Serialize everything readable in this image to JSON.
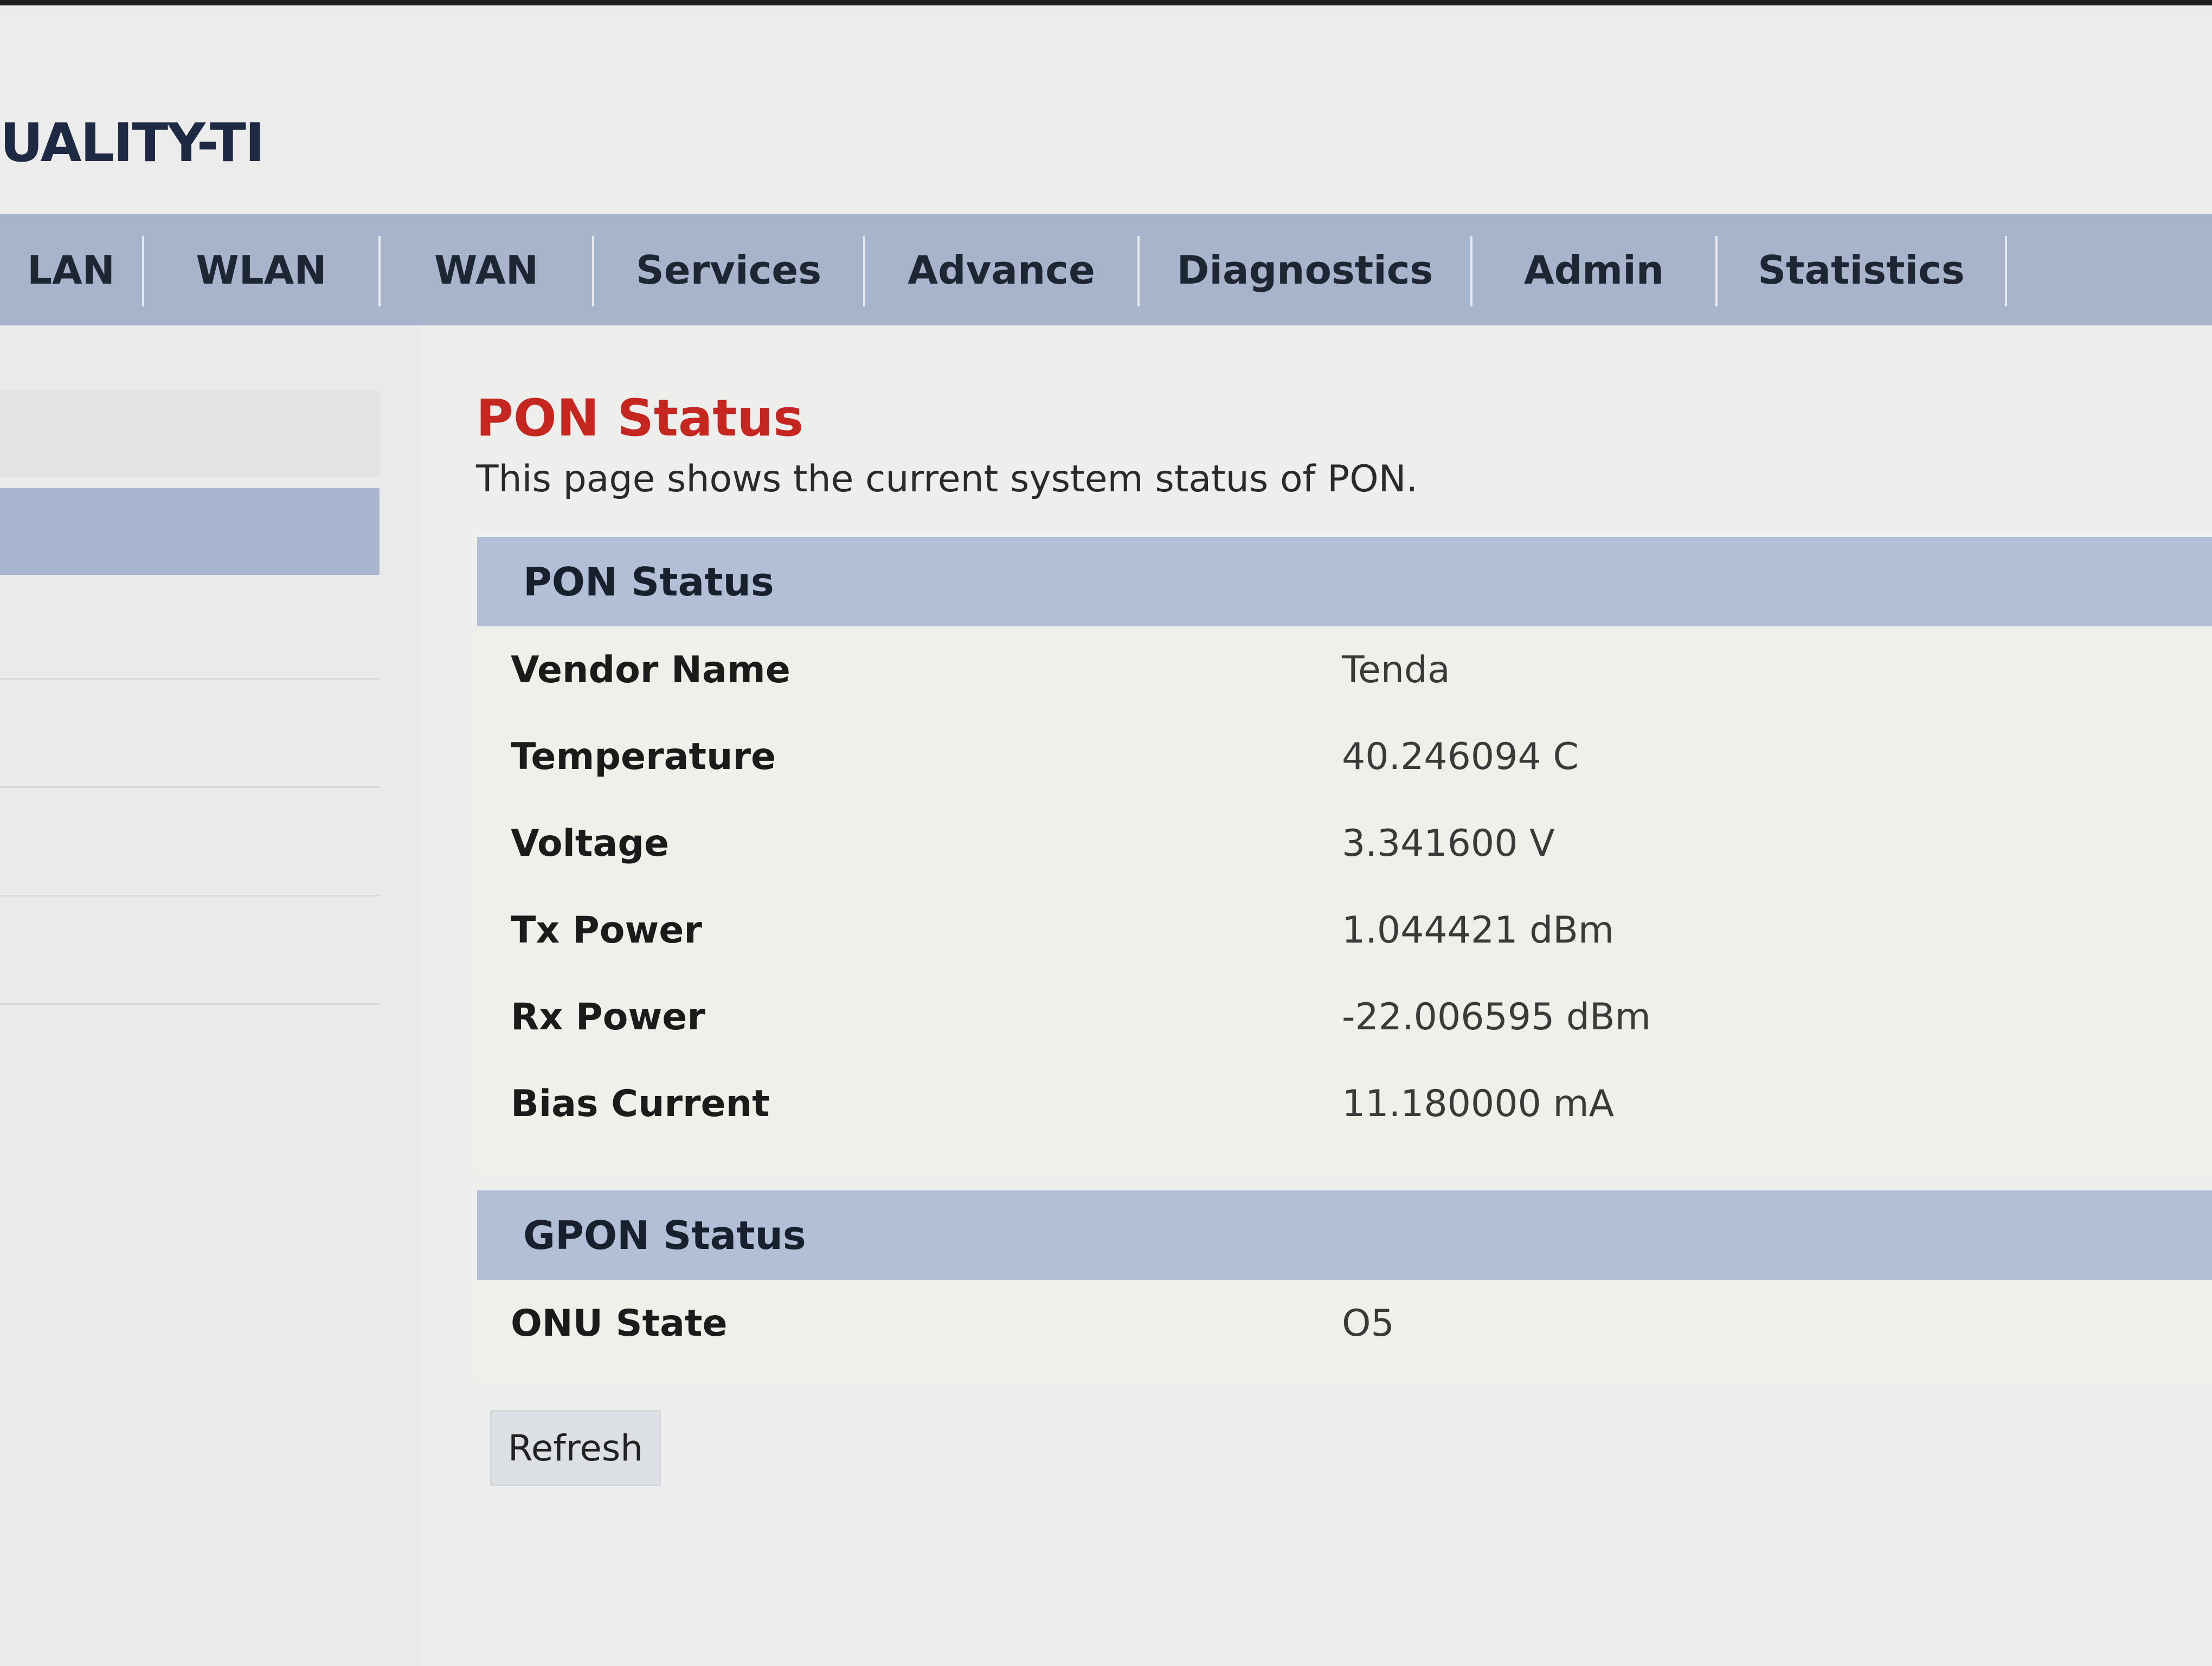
{
  "brand": {
    "title": "UALITY-TI"
  },
  "nav": {
    "items": [
      {
        "label": "LAN"
      },
      {
        "label": "WLAN"
      },
      {
        "label": "WAN"
      },
      {
        "label": "Services"
      },
      {
        "label": "Advance"
      },
      {
        "label": "Diagnostics"
      },
      {
        "label": "Admin"
      },
      {
        "label": "Statistics"
      }
    ]
  },
  "page": {
    "title": "PON Status",
    "description": "This page shows the current system status of PON."
  },
  "pon_status": {
    "header": "PON Status",
    "rows": [
      {
        "label": "Vendor Name",
        "value": "Tenda"
      },
      {
        "label": "Temperature",
        "value": "40.246094 C"
      },
      {
        "label": "Voltage",
        "value": "3.341600 V"
      },
      {
        "label": "Tx Power",
        "value": "1.044421 dBm"
      },
      {
        "label": "Rx Power",
        "value": "-22.006595 dBm"
      },
      {
        "label": "Bias Current",
        "value": "11.180000 mA"
      }
    ]
  },
  "gpon_status": {
    "header": "GPON Status",
    "rows": [
      {
        "label": "ONU State",
        "value": "O5"
      }
    ]
  },
  "actions": {
    "refresh_label": "Refresh"
  },
  "colors": {
    "nav_background": "#a8b4cc",
    "section_header": "#b3bfd7",
    "page_title": "#c5261f"
  }
}
